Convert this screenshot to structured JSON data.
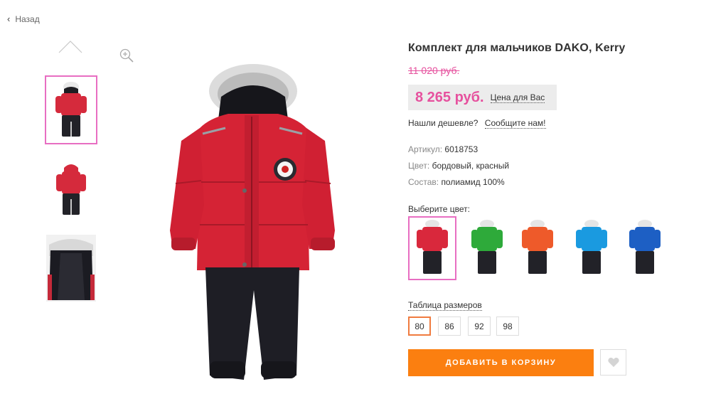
{
  "nav": {
    "back_label": "Назад"
  },
  "product": {
    "title": "Комплект для мальчиков DAKO, Kerry",
    "old_price": "11 020 руб.",
    "price": "8 265 руб.",
    "price_note": "Цена для Вас",
    "cheaper_question": "Нашли дешевле?",
    "cheaper_link": "Сообщите нам!",
    "props": [
      {
        "key": "Артикул:",
        "value": "6018753"
      },
      {
        "key": "Цвет:",
        "value": "бордовый, красный"
      },
      {
        "key": "Состав:",
        "value": "полиамид 100%"
      }
    ],
    "color_label": "Выберите цвет:",
    "colors": [
      {
        "name": "red",
        "hex": "#d9283c"
      },
      {
        "name": "green",
        "hex": "#2eaa3a"
      },
      {
        "name": "orange",
        "hex": "#ee5a2a"
      },
      {
        "name": "light-blue",
        "hex": "#1a9ae0"
      },
      {
        "name": "blue",
        "hex": "#1d5fc4"
      }
    ],
    "size_label": "Таблица размеров",
    "sizes": [
      "80",
      "86",
      "92",
      "98"
    ],
    "add_to_cart": "ДОБАВИТЬ В КОРЗИНУ"
  },
  "colors": {
    "accent_pink": "#e6519e",
    "cart_orange": "#fb7f10",
    "selected_border": "#e86ec2",
    "size_selected": "#f07b3f"
  },
  "icons": [
    "chevron-left-icon",
    "chevron-up-icon",
    "zoom-in-icon",
    "heart-icon"
  ]
}
